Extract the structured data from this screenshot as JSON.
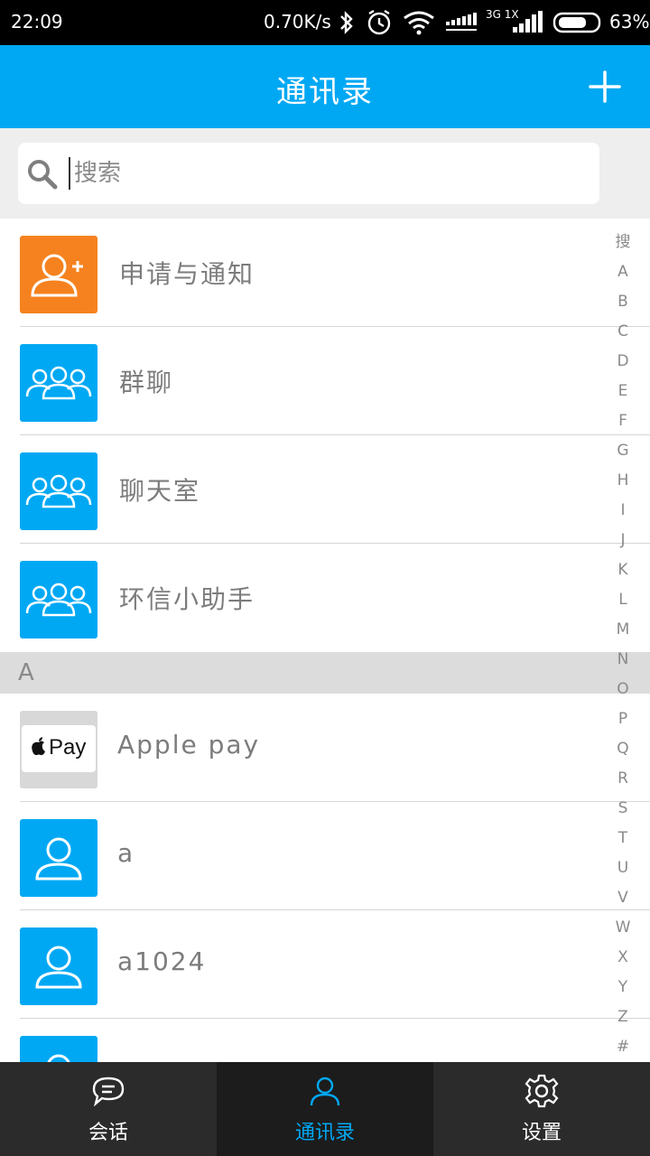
{
  "status_bar": {
    "time": "22:09",
    "speed": "0.70K/s",
    "network": "3G 1X",
    "battery": "63%"
  },
  "header": {
    "title": "通讯录",
    "add_icon": "plus-icon"
  },
  "search": {
    "placeholder": "搜索",
    "icon": "search-icon"
  },
  "fixed_items": [
    {
      "label": "申请与通知",
      "icon": "add-user-icon",
      "color": "#f5821f"
    },
    {
      "label": "群聊",
      "icon": "group-icon",
      "color": "#00a8f3"
    },
    {
      "label": "聊天室",
      "icon": "group-icon",
      "color": "#00a8f3"
    },
    {
      "label": "环信小助手",
      "icon": "group-icon",
      "color": "#00a8f3"
    }
  ],
  "sections": [
    {
      "letter": "A",
      "contacts": [
        {
          "label": "Apple pay",
          "avatar_text": "Pay",
          "icon": "apple-icon"
        },
        {
          "label": "a",
          "icon": "user-icon"
        },
        {
          "label": "a1024",
          "icon": "user-icon"
        }
      ]
    }
  ],
  "index_bar": [
    "搜",
    "A",
    "B",
    "C",
    "D",
    "E",
    "F",
    "G",
    "H",
    "I",
    "J",
    "K",
    "L",
    "M",
    "N",
    "O",
    "P",
    "Q",
    "R",
    "S",
    "T",
    "U",
    "V",
    "W",
    "X",
    "Y",
    "Z",
    "#"
  ],
  "bottom_nav": [
    {
      "label": "会话",
      "icon": "chat-icon",
      "active": false
    },
    {
      "label": "通讯录",
      "icon": "contacts-icon",
      "active": true
    },
    {
      "label": "设置",
      "icon": "gear-icon",
      "active": false
    }
  ],
  "colors": {
    "accent": "#00a8f3",
    "orange": "#f5821f",
    "nav_bg": "#2b2b2b"
  }
}
